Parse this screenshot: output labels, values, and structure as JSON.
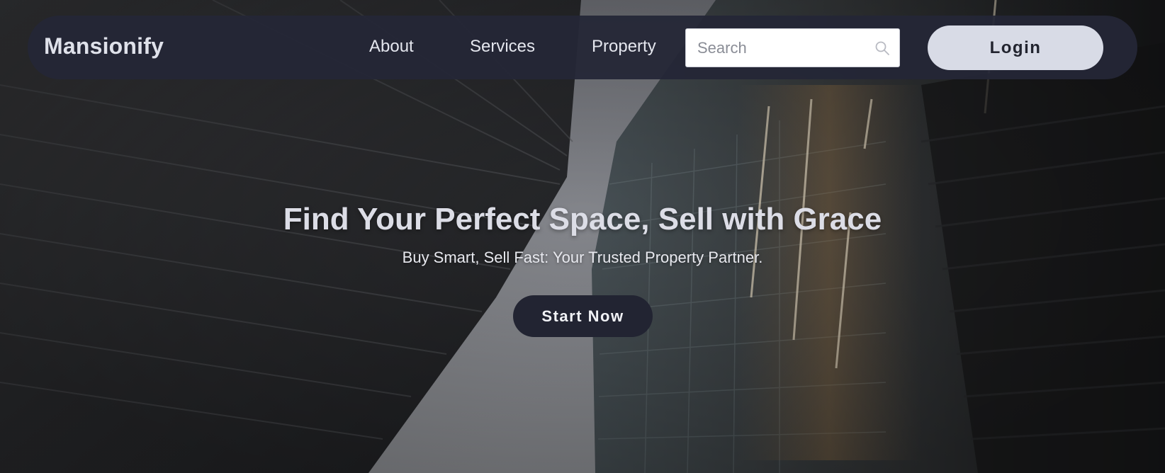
{
  "navbar": {
    "brand": "Mansionify",
    "links": [
      {
        "label": "About"
      },
      {
        "label": "Services"
      },
      {
        "label": "Property"
      }
    ],
    "search": {
      "placeholder": "Search",
      "value": "",
      "icon": "search-icon"
    },
    "login_label": "Login"
  },
  "hero": {
    "title": "Find Your Perfect Space, Sell with Grace",
    "subtitle": "Buy Smart, Sell Fast: Your Trusted Property Partner.",
    "cta_label": "Start Now"
  },
  "colors": {
    "navbar_bg": "#242636",
    "brand_text": "#dfe1ea",
    "login_bg": "#d8dbe6",
    "cta_bg": "#222432",
    "hero_text": "#dcdde6"
  }
}
